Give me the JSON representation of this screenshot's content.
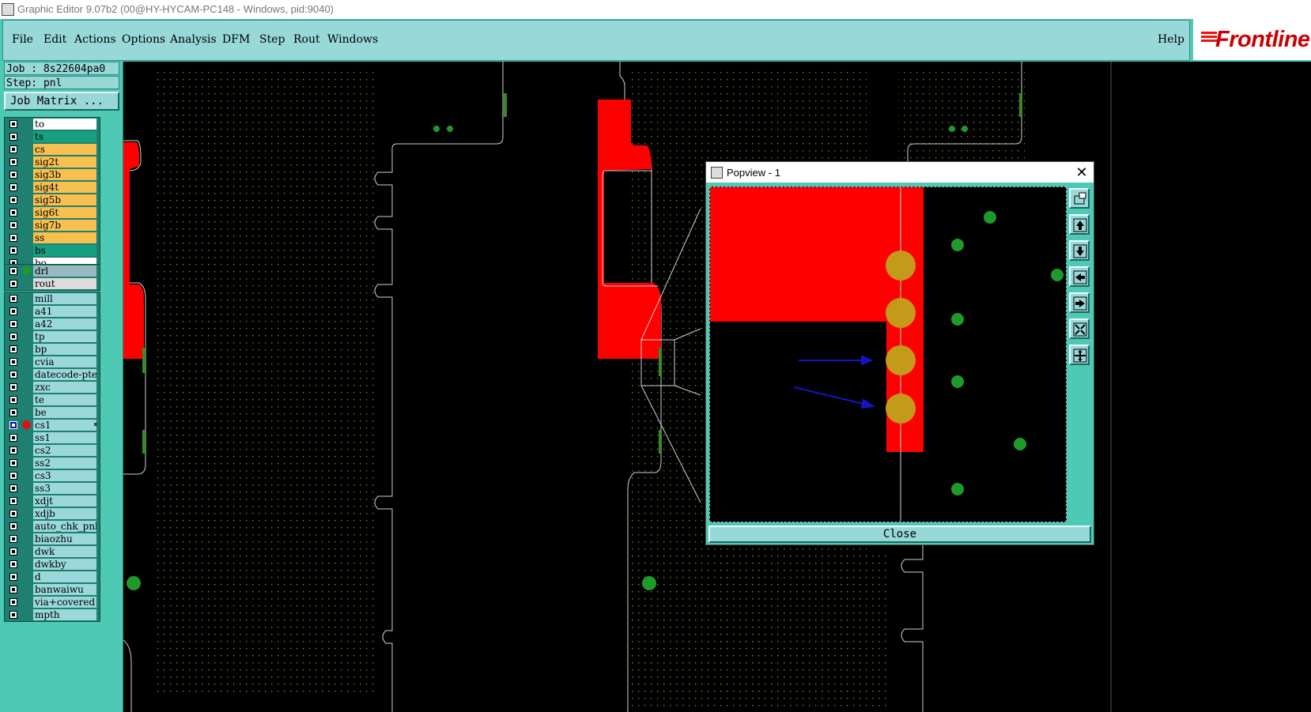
{
  "window": {
    "title": "Graphic Editor 9.07b2 (00@HY-HYCAM-PC148 - Windows, pid:9040)"
  },
  "menu": {
    "items": [
      "File",
      "Edit",
      "Actions",
      "Options",
      "Analysis",
      "DFM",
      "Step",
      "Rout",
      "Windows"
    ],
    "help": "Help"
  },
  "logo": {
    "text": "Frontline"
  },
  "job": {
    "job_label": "Job : 8s22604pa0",
    "step_label": "Step: pnl",
    "matrix_button": "Job Matrix ..."
  },
  "layers": {
    "board": [
      {
        "name": "to",
        "color": "white"
      },
      {
        "name": "ts",
        "color": "teal"
      },
      {
        "name": "cs",
        "color": "orange"
      },
      {
        "name": "sig2t",
        "color": "orange"
      },
      {
        "name": "sig3b",
        "color": "orange"
      },
      {
        "name": "sig4t",
        "color": "orange"
      },
      {
        "name": "sig5b",
        "color": "orange"
      },
      {
        "name": "sig6t",
        "color": "orange"
      },
      {
        "name": "sig7b",
        "color": "orange"
      },
      {
        "name": "ss",
        "color": "orange"
      },
      {
        "name": "bs",
        "color": "teal"
      },
      {
        "name": "bo",
        "color": "white"
      }
    ],
    "drill": [
      {
        "name": "drl",
        "color": "gray",
        "dot": "#1f9a2a"
      },
      {
        "name": "rout",
        "color": "lgray"
      }
    ],
    "misc": [
      {
        "name": "mill"
      },
      {
        "name": "a41"
      },
      {
        "name": "a42"
      },
      {
        "name": "tp"
      },
      {
        "name": "bp"
      },
      {
        "name": "cvia"
      },
      {
        "name": "datecode-pte"
      },
      {
        "name": "zxc"
      },
      {
        "name": "te"
      },
      {
        "name": "be"
      },
      {
        "name": "cs1",
        "selected": true,
        "dot": "#e01010"
      },
      {
        "name": "ss1"
      },
      {
        "name": "cs2"
      },
      {
        "name": "ss2"
      },
      {
        "name": "cs3"
      },
      {
        "name": "ss3"
      },
      {
        "name": "xdjt"
      },
      {
        "name": "xdjb"
      },
      {
        "name": "auto_chk_pnl"
      },
      {
        "name": "biaozhu"
      },
      {
        "name": "dwk"
      },
      {
        "name": "dwkby"
      },
      {
        "name": "d"
      },
      {
        "name": "banwaiwu"
      },
      {
        "name": "via+covered"
      },
      {
        "name": "mpth"
      }
    ]
  },
  "popview": {
    "title": "Popview - 1",
    "close_label": "Close"
  },
  "colors": {
    "panel": "#4dc9b5",
    "field": "#98d8d8",
    "copper": "#ff0000",
    "pad": "#c49a1a",
    "via": "#1f9a2a",
    "arrow": "#1515c8"
  }
}
